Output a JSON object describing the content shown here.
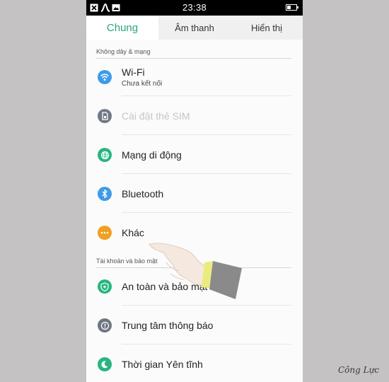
{
  "statusbar": {
    "time": "23:38"
  },
  "tabs": [
    {
      "label": "Chung",
      "active": true
    },
    {
      "label": "Âm thanh",
      "active": false
    },
    {
      "label": "Hiển thị",
      "active": false
    }
  ],
  "sections": {
    "wireless": {
      "header": "Không dây & mạng"
    },
    "account": {
      "header": "Tài khoản và bảo mật"
    }
  },
  "items": {
    "wifi": {
      "title": "Wi-Fi",
      "subtitle": "Chưa kết nối",
      "icon": "wifi-icon",
      "color": "#3d9be9"
    },
    "sim": {
      "title": "Cài đặt thẻ SIM",
      "icon": "sim-card-icon",
      "color": "#707a85",
      "disabled": true
    },
    "mobile": {
      "title": "Mạng di động",
      "icon": "globe-icon",
      "color": "#27b580"
    },
    "bluetooth": {
      "title": "Bluetooth",
      "icon": "bluetooth-icon",
      "color": "#3d9be9"
    },
    "other": {
      "title": "Khác",
      "icon": "more-dots-icon",
      "color": "#f0a020"
    },
    "security": {
      "title": "An toàn và bảo mật",
      "icon": "shield-icon",
      "color": "#27b580"
    },
    "notifications": {
      "title": "Trung tâm thông báo",
      "icon": "exclamation-icon",
      "color": "#6f7782"
    },
    "quiet": {
      "title": "Thời gian Yên tĩnh",
      "icon": "moon-icon",
      "color": "#27b580"
    }
  },
  "watermark": "Công Lực"
}
